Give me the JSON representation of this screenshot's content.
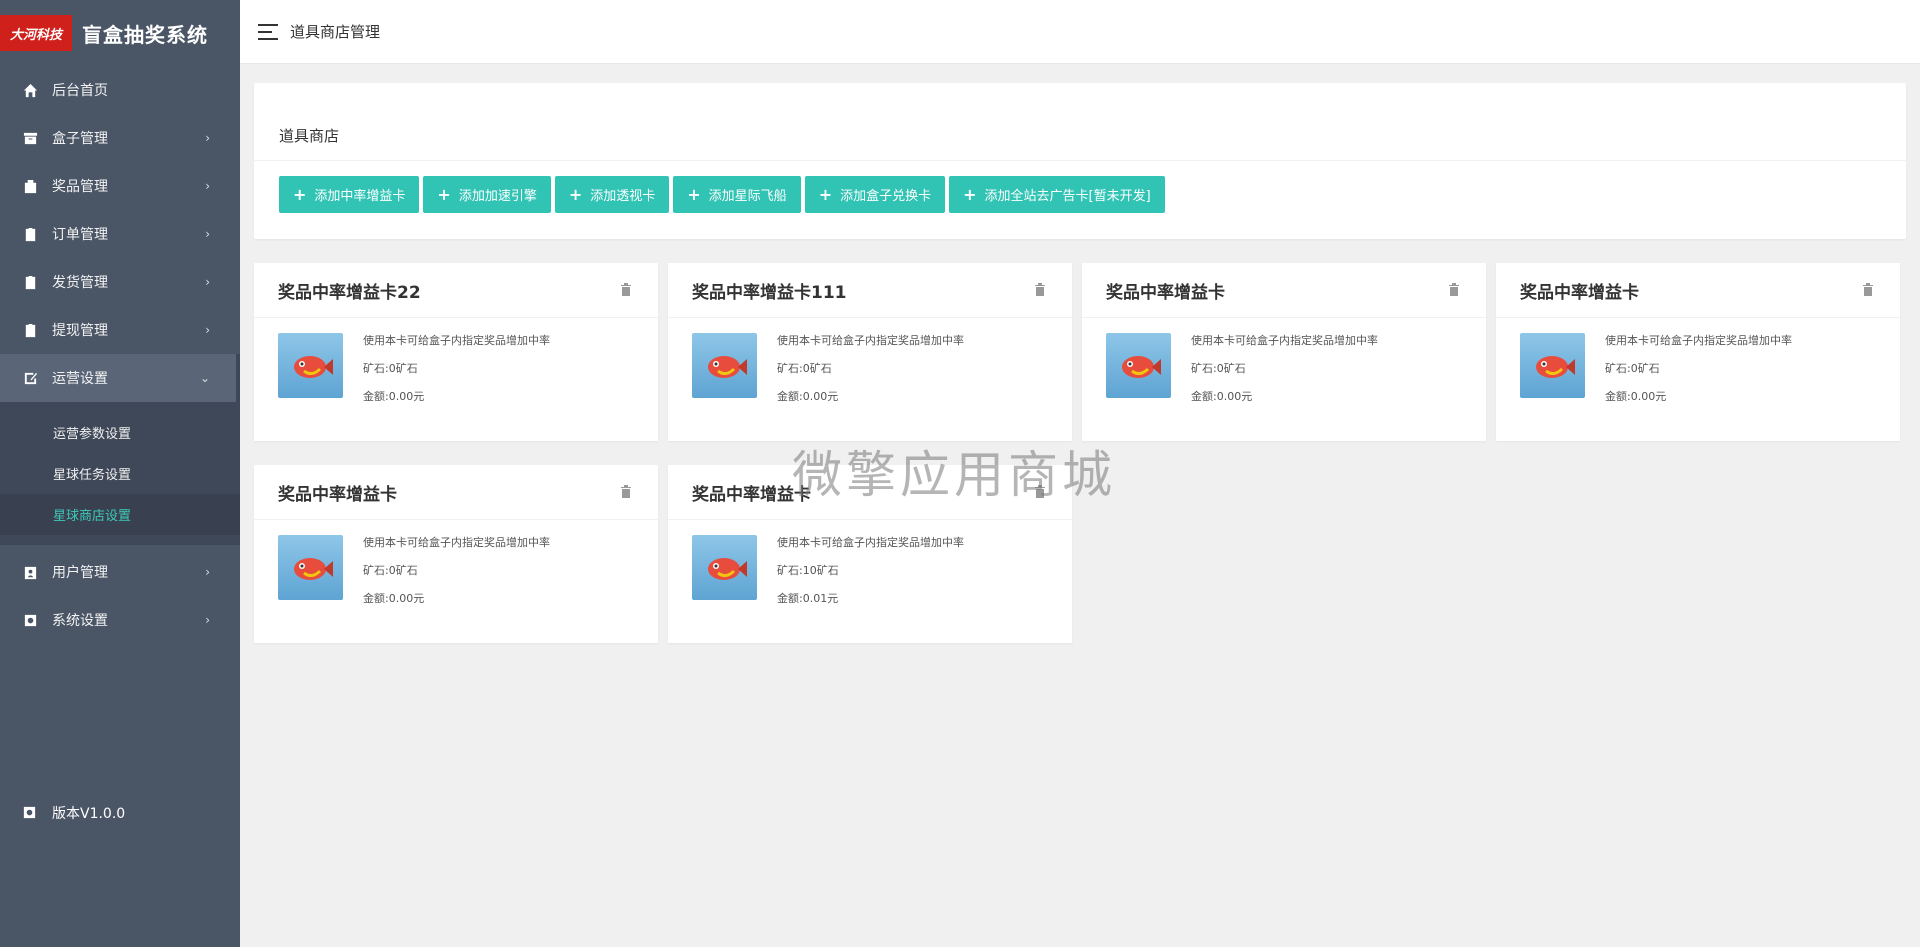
{
  "brand": {
    "logo_text": "大河科技",
    "name": "盲盒抽奖系统"
  },
  "sidebar": {
    "items": [
      {
        "label": "后台首页",
        "icon": "home-icon",
        "arrow": ""
      },
      {
        "label": "盒子管理",
        "icon": "box-icon",
        "arrow": "›"
      },
      {
        "label": "奖品管理",
        "icon": "gift-icon",
        "arrow": "›"
      },
      {
        "label": "订单管理",
        "icon": "clipboard-icon",
        "arrow": "›"
      },
      {
        "label": "发货管理",
        "icon": "clipboard-icon",
        "arrow": "›"
      },
      {
        "label": "提现管理",
        "icon": "clipboard-icon",
        "arrow": "›"
      },
      {
        "label": "运营设置",
        "icon": "edit-icon",
        "arrow": "⌄"
      },
      {
        "label": "用户管理",
        "icon": "user-icon",
        "arrow": "›"
      },
      {
        "label": "系统设置",
        "icon": "gear-icon",
        "arrow": "›"
      }
    ],
    "sub_items": [
      "运营参数设置",
      "星球任务设置",
      "星球商店设置"
    ],
    "version": "版本V1.0.0"
  },
  "header": {
    "title": "道具商店管理"
  },
  "panel": {
    "title": "道具商店",
    "buttons": [
      "添加中率增益卡",
      "添加加速引擎",
      "添加透视卡",
      "添加星际飞船",
      "添加盒子兑换卡",
      "添加全站去广告卡[暂未开发]"
    ]
  },
  "cards": [
    {
      "title": "奖品中率增益卡22",
      "desc": "使用本卡可给盒子内指定奖品增加中率",
      "ore": "矿石:0矿石",
      "amount": "金额:0.00元"
    },
    {
      "title": "奖品中率增益卡111",
      "desc": "使用本卡可给盒子内指定奖品增加中率",
      "ore": "矿石:0矿石",
      "amount": "金额:0.00元"
    },
    {
      "title": "奖品中率增益卡",
      "desc": "使用本卡可给盒子内指定奖品增加中率",
      "ore": "矿石:0矿石",
      "amount": "金额:0.00元"
    },
    {
      "title": "奖品中率增益卡",
      "desc": "使用本卡可给盒子内指定奖品增加中率",
      "ore": "矿石:0矿石",
      "amount": "金额:0.00元"
    },
    {
      "title": "奖品中率增益卡",
      "desc": "使用本卡可给盒子内指定奖品增加中率",
      "ore": "矿石:0矿石",
      "amount": "金额:0.00元"
    },
    {
      "title": "奖品中率增益卡",
      "desc": "使用本卡可给盒子内指定奖品增加中率",
      "ore": "矿石:10矿石",
      "amount": "金额:0.01元"
    }
  ],
  "watermark": "微擎应用商城",
  "colors": {
    "sidebar_bg": "#4a5566",
    "accent": "#31c4b5",
    "active_sub": "#3dc9b8",
    "logo_red": "#d0201b"
  }
}
